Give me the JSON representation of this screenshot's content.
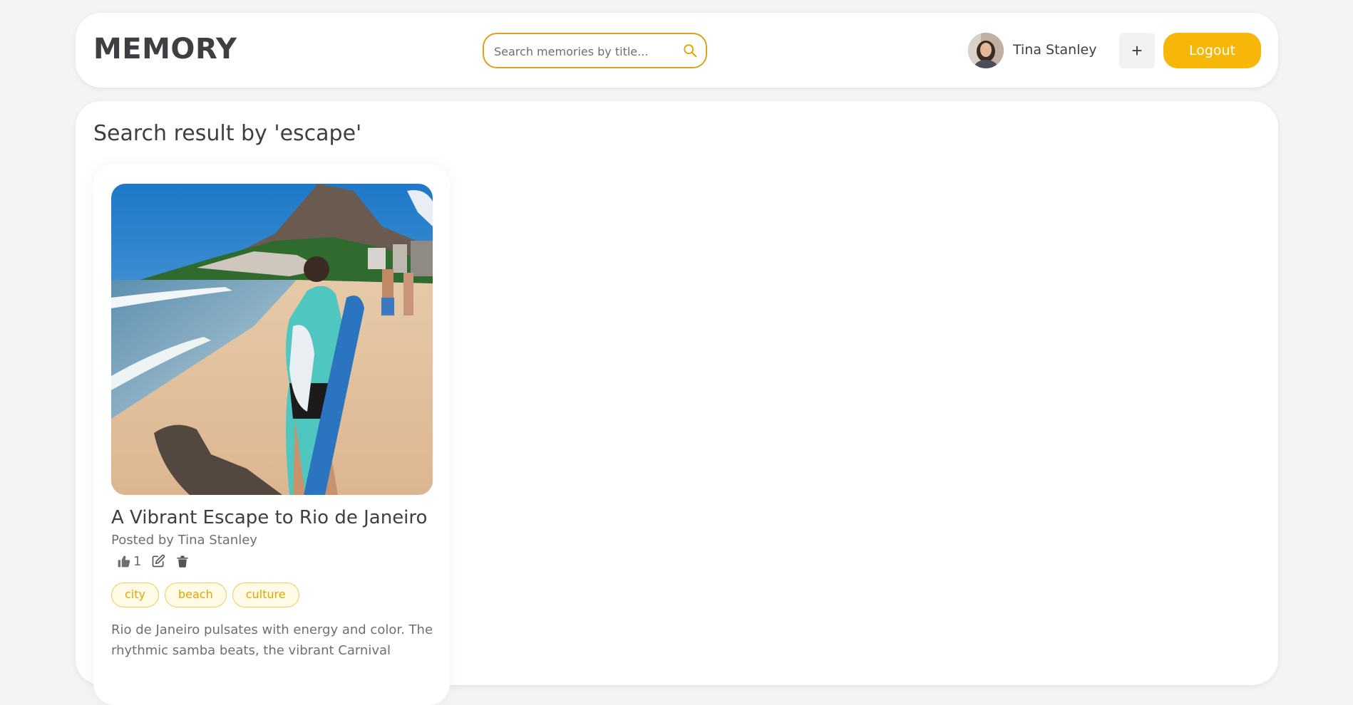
{
  "header": {
    "logo": "MEMORY",
    "search_placeholder": "Search memories by title...",
    "user_name": "Tina Stanley",
    "add_label": "+",
    "logout_label": "Logout"
  },
  "main": {
    "result_title": "Search result by 'escape'",
    "cards": [
      {
        "title": "A Vibrant Escape to Rio de Janeiro",
        "posted_by": "Posted by Tina Stanley",
        "likes": "1",
        "tags": [
          "city",
          "beach",
          "culture"
        ],
        "description": "Rio de Janeiro pulsates with energy and color. The rhythmic samba beats, the vibrant Carnival"
      }
    ]
  },
  "colors": {
    "accent": "#f6b60a",
    "search_border": "#d8a21b",
    "tag_text": "#e5a400",
    "text_dark": "#3d3f43",
    "text_muted": "#6f6f6f"
  },
  "icons": {
    "search": "search-icon",
    "like": "thumbs-up-icon",
    "edit": "edit-icon",
    "delete": "trash-icon"
  }
}
